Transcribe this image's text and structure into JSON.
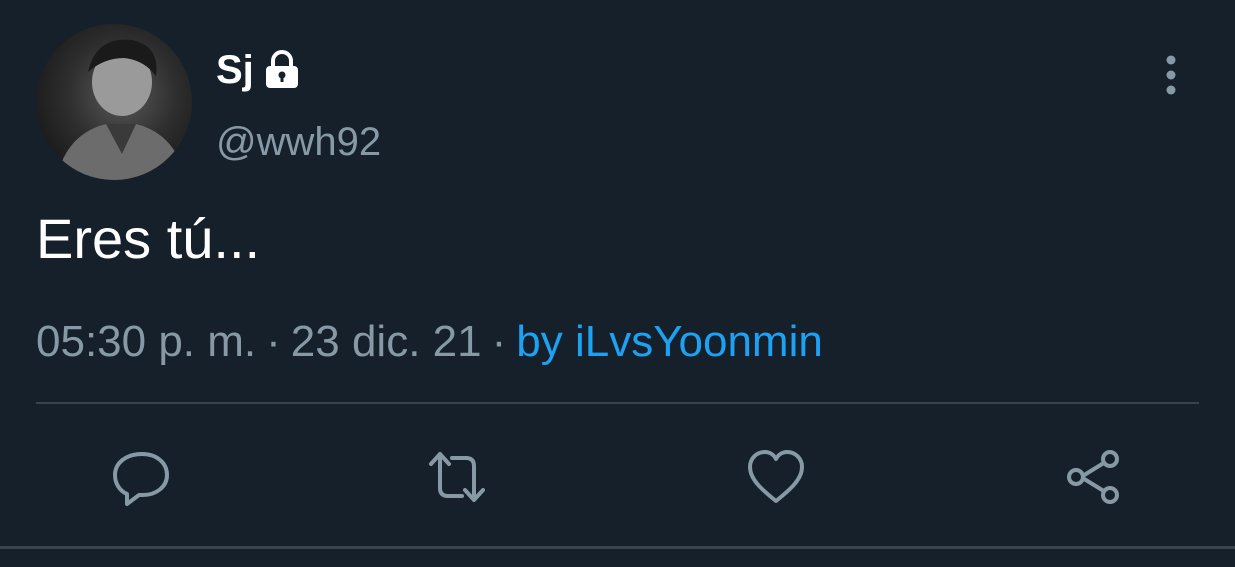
{
  "tweet": {
    "display_name": "Sj",
    "handle": "@wwh92",
    "text": "Eres tú...",
    "time": "05:30 p. m.",
    "separator": "·",
    "date": "23 dic. 21",
    "source": "by iLvsYoonmin"
  },
  "icons": {
    "lock": "lock-icon",
    "more": "more-vertical-icon",
    "reply": "reply-icon",
    "retweet": "retweet-icon",
    "like": "heart-icon",
    "share": "share-icon"
  },
  "colors": {
    "background": "#15202b",
    "primary_text": "#ffffff",
    "secondary_text": "#8899a6",
    "link": "#1da1f2",
    "divider": "#38444d"
  }
}
